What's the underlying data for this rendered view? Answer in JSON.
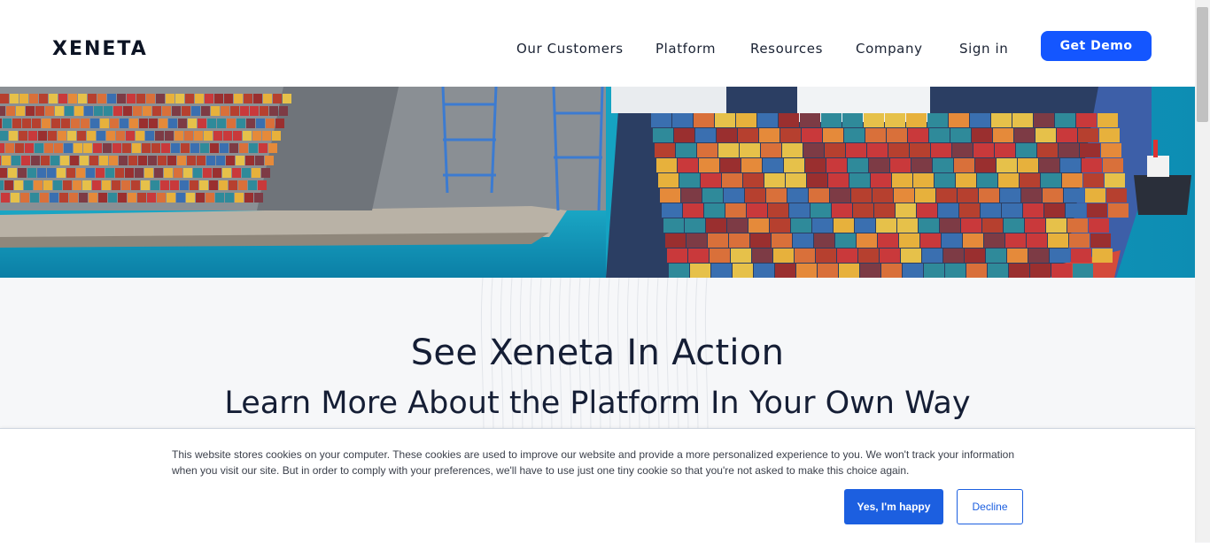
{
  "header": {
    "logo": "XENETA",
    "nav": [
      "Our Customers",
      "Platform",
      "Resources",
      "Company",
      "Sign in"
    ],
    "cta": "Get Demo"
  },
  "hero": {
    "image": "container-port-and-cargo-ship-photo"
  },
  "main": {
    "title": "See Xeneta In Action",
    "subtitle": "Learn More About the Platform In Your Own Way"
  },
  "cookie_banner": {
    "text": "This website stores cookies on your computer. These cookies are used to improve our website and provide a more personalized experience to you. We won't track your information when you visit our site. But in order to comply with your preferences, we'll have to use just one tiny cookie so that you're not asked to make this choice again.",
    "accept": "Yes, I'm happy",
    "decline": "Decline"
  },
  "colors": {
    "brand_blue": "#1456ff",
    "cookie_blue": "#1c5fe0",
    "heading": "#151e35"
  }
}
